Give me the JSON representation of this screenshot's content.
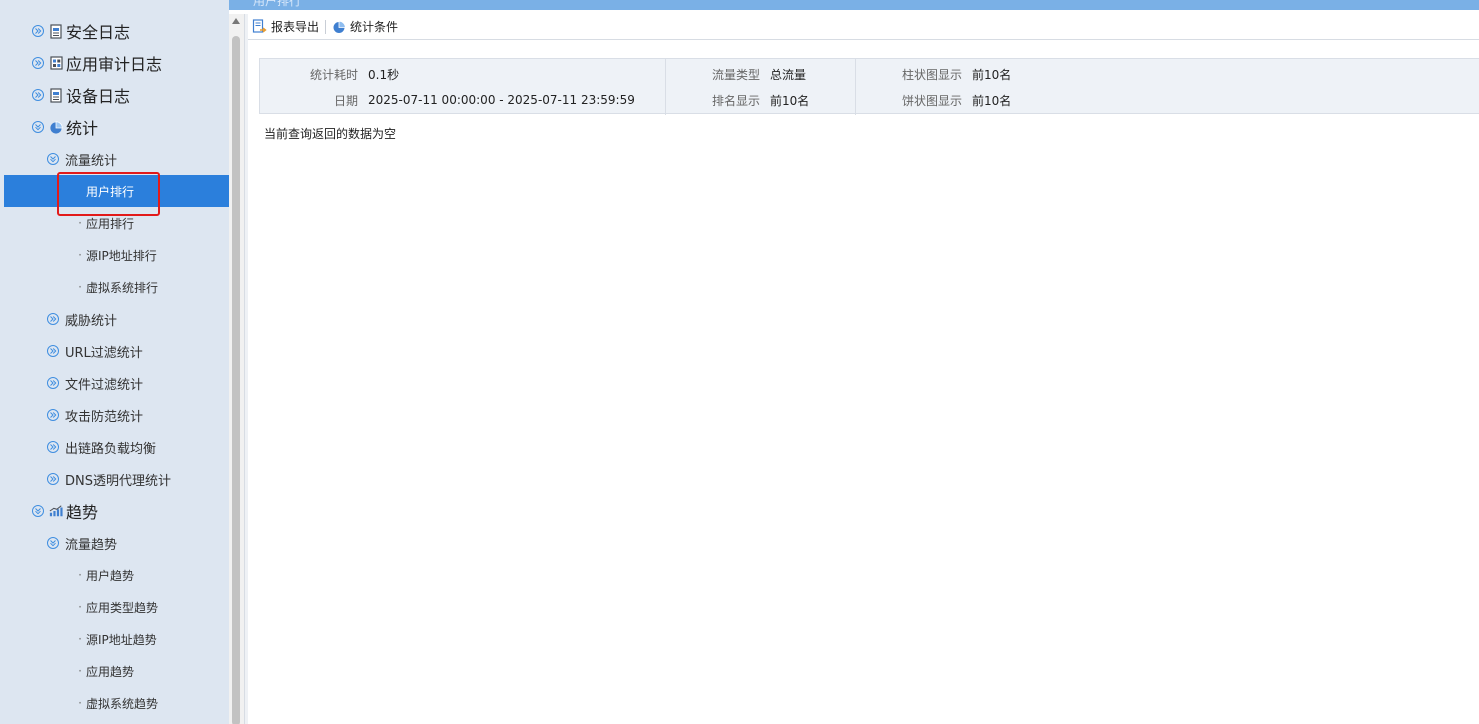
{
  "tab": {
    "title": "用户排行"
  },
  "sidebar": {
    "items": [
      {
        "label": "安全日志",
        "level": 1,
        "expanded": false,
        "icon": "log-icon"
      },
      {
        "label": "应用审计日志",
        "level": 1,
        "expanded": false,
        "icon": "grid-icon"
      },
      {
        "label": "设备日志",
        "level": 1,
        "expanded": false,
        "icon": "log-icon"
      },
      {
        "label": "统计",
        "level": 1,
        "expanded": true,
        "icon": "pie-icon"
      },
      {
        "label": "流量统计",
        "level": 2,
        "expanded": true
      },
      {
        "label": "用户排行",
        "level": 3,
        "active": true
      },
      {
        "label": "应用排行",
        "level": 3
      },
      {
        "label": "源IP地址排行",
        "level": 3
      },
      {
        "label": "虚拟系统排行",
        "level": 3
      },
      {
        "label": "威胁统计",
        "level": 2,
        "expanded": false
      },
      {
        "label": "URL过滤统计",
        "level": 2,
        "expanded": false
      },
      {
        "label": "文件过滤统计",
        "level": 2,
        "expanded": false
      },
      {
        "label": "攻击防范统计",
        "level": 2,
        "expanded": false
      },
      {
        "label": "出链路负载均衡",
        "level": 2,
        "expanded": false
      },
      {
        "label": "DNS透明代理统计",
        "level": 2,
        "expanded": false
      },
      {
        "label": "趋势",
        "level": 1,
        "expanded": true,
        "icon": "trend-icon"
      },
      {
        "label": "流量趋势",
        "level": 2,
        "expanded": true
      },
      {
        "label": "用户趋势",
        "level": 3
      },
      {
        "label": "应用类型趋势",
        "level": 3
      },
      {
        "label": "源IP地址趋势",
        "level": 3
      },
      {
        "label": "应用趋势",
        "level": 3
      },
      {
        "label": "虚拟系统趋势",
        "level": 3
      }
    ],
    "dot_glyph": "·"
  },
  "toolbar": {
    "export_label": "报表导出",
    "conditions_label": "统计条件"
  },
  "info": {
    "duration_label": "统计耗时",
    "duration_value": "0.1秒",
    "date_label": "日期",
    "date_value": "2025-07-11 00:00:00 - 2025-07-11 23:59:59",
    "traffic_type_label": "流量类型",
    "traffic_type_value": "总流量",
    "rank_display_label": "排名显示",
    "rank_display_value": "前10名",
    "bar_display_label": "柱状图显示",
    "bar_display_value": "前10名",
    "pie_display_label": "饼状图显示",
    "pie_display_value": "前10名"
  },
  "main": {
    "empty_message": "当前查询返回的数据为空"
  },
  "colors": {
    "accent": "#2b7fdc",
    "sidebar_bg": "#dde6f1",
    "highlight": "#e21a1a"
  }
}
